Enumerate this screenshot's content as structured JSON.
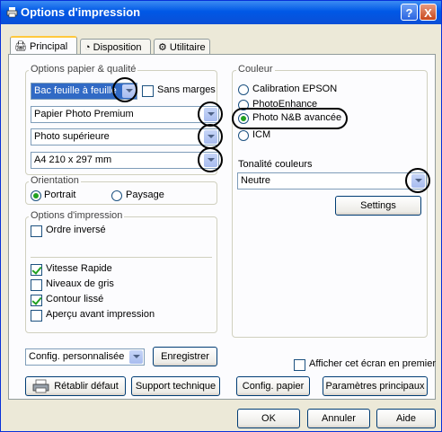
{
  "window": {
    "title": "Options d'impression",
    "help_glyph": "?",
    "close_glyph": "X"
  },
  "tabs": [
    {
      "label": "Principal",
      "icon": "printer-icon"
    },
    {
      "label": "Disposition",
      "icon": "layout-icon"
    },
    {
      "label": "Utilitaire",
      "icon": "utility-icon"
    }
  ],
  "paper_quality": {
    "group_title": "Options papier & qualité",
    "source_value": "Bac feuille à feuille",
    "borderless_label": "Sans marges",
    "media_value": "Papier Photo Premium",
    "quality_value": "Photo supérieure",
    "size_value": "A4 210 x 297 mm"
  },
  "orientation": {
    "group_title": "Orientation",
    "portrait_label": "Portrait",
    "landscape_label": "Paysage",
    "selected": "portrait"
  },
  "print_options": {
    "group_title": "Options d'impression",
    "reverse_order_label": "Ordre inversé",
    "high_speed_label": "Vitesse Rapide",
    "grayscale_label": "Niveaux de gris",
    "smooth_edge_label": "Contour lissé",
    "preview_label": "Aperçu avant impression",
    "reverse_order_checked": false,
    "high_speed_checked": true,
    "grayscale_checked": false,
    "smooth_edge_checked": true,
    "preview_checked": false
  },
  "color": {
    "group_title": "Couleur",
    "options": [
      "Calibration EPSON",
      "PhotoEnhance",
      "Photo N&B avancée",
      "ICM"
    ],
    "selected_index": 2,
    "tone_label": "Tonalité couleurs",
    "tone_value": "Neutre",
    "settings_button": "Settings"
  },
  "custom_settings": {
    "value": "Config. personnalisée",
    "save_button": "Enregistrer"
  },
  "show_first_label": "Afficher cet écran en premier",
  "buttons": {
    "reset": "Rétablir défaut",
    "support": "Support technique",
    "paper_config": "Config. papier",
    "main_settings": "Paramètres principaux",
    "ok": "OK",
    "cancel": "Annuler",
    "help": "Aide"
  },
  "colors": {
    "title_bar": "#0058e6",
    "dialog_bg": "#ece9d8",
    "panel_bg": "#fcfcfe",
    "check_green": "#21a121"
  }
}
